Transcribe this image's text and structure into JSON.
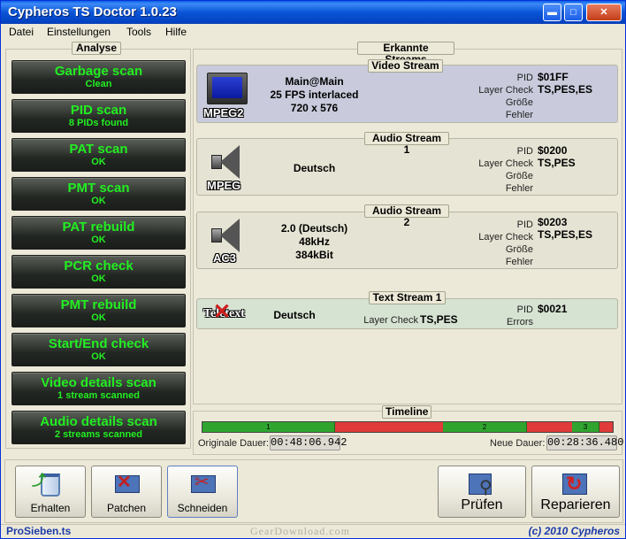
{
  "window": {
    "title": "Cypheros TS Doctor 1.0.23",
    "controls": {
      "minimize": "▬",
      "maximize": "□",
      "close": "✕"
    }
  },
  "menu": [
    "Datei",
    "Einstellungen",
    "Tools",
    "Hilfe"
  ],
  "analyse": {
    "title": "Analyse",
    "buttons": [
      {
        "label": "Garbage scan",
        "status": "Clean"
      },
      {
        "label": "PID scan",
        "status": "8 PIDs found"
      },
      {
        "label": "PAT scan",
        "status": "OK"
      },
      {
        "label": "PMT scan",
        "status": "OK"
      },
      {
        "label": "PAT rebuild",
        "status": "OK"
      },
      {
        "label": "PCR check",
        "status": "OK"
      },
      {
        "label": "PMT rebuild",
        "status": "OK"
      },
      {
        "label": "Start/End check",
        "status": "OK"
      },
      {
        "label": "Video details scan",
        "status": "1 stream scanned"
      },
      {
        "label": "Audio details scan",
        "status": "2 streams scanned"
      }
    ]
  },
  "streams": {
    "title": "Erkannte Streams",
    "video": {
      "title": "Video Stream",
      "codec": "MPEG2",
      "icon": "monitor-icon",
      "info": [
        "Main@Main",
        "25 FPS interlaced",
        "720 x 576"
      ],
      "labels": [
        "PID",
        "Layer Check",
        "Größe",
        "Fehler"
      ],
      "values": [
        "$01FF",
        "TS,PES,ES"
      ]
    },
    "audio1": {
      "title": "Audio Stream 1",
      "codec": "MPEG",
      "icon": "speaker-icon",
      "info": [
        "Deutsch"
      ],
      "labels": [
        "PID",
        "Layer Check",
        "Größe",
        "Fehler"
      ],
      "values": [
        "$0200",
        "TS,PES"
      ]
    },
    "audio2": {
      "title": "Audio Stream 2",
      "codec": "AC3",
      "icon": "speaker-icon",
      "info": [
        "2.0 (Deutsch)",
        "48kHz",
        "384kBit"
      ],
      "labels": [
        "PID",
        "Layer Check",
        "Größe",
        "Fehler"
      ],
      "values": [
        "$0203",
        "TS,PES,ES"
      ]
    },
    "text1": {
      "title": "Text Stream 1",
      "codec": "Teletext",
      "icon": "teletext-icon",
      "info": "Deutsch",
      "layer_label": "Layer Check",
      "layer_value": "TS,PES",
      "labels": [
        "PID",
        "Errors"
      ],
      "values": [
        "$0021"
      ]
    }
  },
  "timeline": {
    "title": "Timeline",
    "segments": [
      "1",
      "2",
      "3"
    ],
    "orig_label": "Originale Dauer:",
    "orig_value": "00:48:06.942",
    "new_label": "Neue Dauer:",
    "new_value": "00:28:36.480",
    "colors": {
      "keep": "#2fa52f",
      "cut": "#e03a3a"
    }
  },
  "toolbar": {
    "erhalten": "Erhalten",
    "patchen": "Patchen",
    "schneiden": "Schneiden",
    "pruefen": "Prüfen",
    "reparieren": "Reparieren"
  },
  "status": {
    "file": "ProSieben.ts",
    "copyright": "(c) 2010 Cypheros"
  },
  "watermark": "GearDownload.com"
}
